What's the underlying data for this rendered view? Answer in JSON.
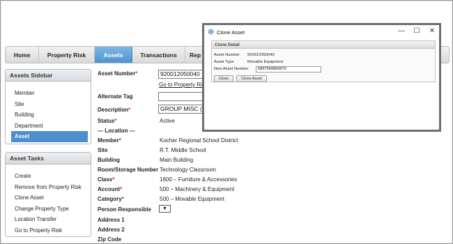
{
  "nav": {
    "tabs": [
      {
        "label": "Home"
      },
      {
        "label": "Property Risk"
      },
      {
        "label": "Assets"
      },
      {
        "label": "Transactions"
      },
      {
        "label": "Rep"
      }
    ]
  },
  "sidebar": {
    "title": "Assets Sidebar",
    "items": [
      {
        "label": "Member"
      },
      {
        "label": "Site"
      },
      {
        "label": "Building"
      },
      {
        "label": "Department"
      },
      {
        "label": "Asset"
      }
    ]
  },
  "tasks": {
    "title": "Asset Tasks",
    "items": [
      {
        "label": "Create"
      },
      {
        "label": "Remove from Property Risk"
      },
      {
        "label": "Clone Asset"
      },
      {
        "label": "Change Property Type"
      },
      {
        "label": "Location Transfer"
      },
      {
        "label": "Go to Property Risk"
      }
    ]
  },
  "form": {
    "asset_number_label": "Asset Number",
    "asset_number_value": "920012050040",
    "go_to_property_link": "Go to Property Ris",
    "alternate_tag_label": "Alternate Tag",
    "alternate_tag_value": "",
    "description_label": "Description",
    "description_value": "GROUP MISC (",
    "status_label": "Status",
    "status_value": "Active",
    "location_header": "--- Location ---",
    "member_label": "Member",
    "member_value": "Kocher Regional School District",
    "site_label": "Site",
    "site_value": "R.T. Middle School",
    "building_label": "Building",
    "building_value": "Main Building",
    "room_label": "Room/Storage Number",
    "room_value": "Technology Classroom",
    "class_label": "Class",
    "class_value": "1600 – Furniture & Accessories",
    "account_label": "Account",
    "account_value": "500 – Machinery & Equipment",
    "category_label": "Category",
    "category_value": "500 – Movable Equipment",
    "person_label": "Person Responsible",
    "person_select": "▼",
    "address1_label": "Address 1",
    "address2_label": "Address 2",
    "zip_label": "Zip Code",
    "required_mark": "*"
  },
  "dialog": {
    "title": "Clone Asset",
    "minimize": "—",
    "maximize": "☐",
    "close": "✕",
    "section_title": "Clone Detail",
    "asset_number_label": "Asset Number",
    "asset_number_value": "920012050040",
    "asset_type_label": "Asset Type",
    "asset_type_value": "Movable Equipment",
    "new_asset_label": "New Asset Number",
    "new_asset_value": "5897594856879",
    "close_button": "Close",
    "clone_button": "Clone Asset"
  }
}
